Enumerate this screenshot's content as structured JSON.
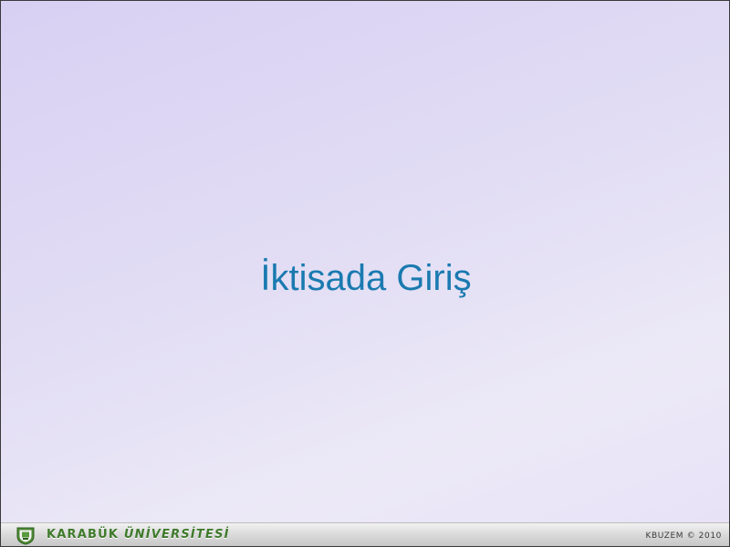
{
  "slide": {
    "title": "İktisada Giriş"
  },
  "footer": {
    "university_word1": "KARABÜK",
    "university_word2": "ÜNİVERSİTESİ",
    "copyright": "KBUZEM © 2010",
    "logo_icon": "university-seal-icon"
  },
  "colors": {
    "title": "#1a7ab0",
    "university_name": "#3f7a2c",
    "background_start": "#d8d0f3",
    "background_end": "#ece9f7"
  }
}
